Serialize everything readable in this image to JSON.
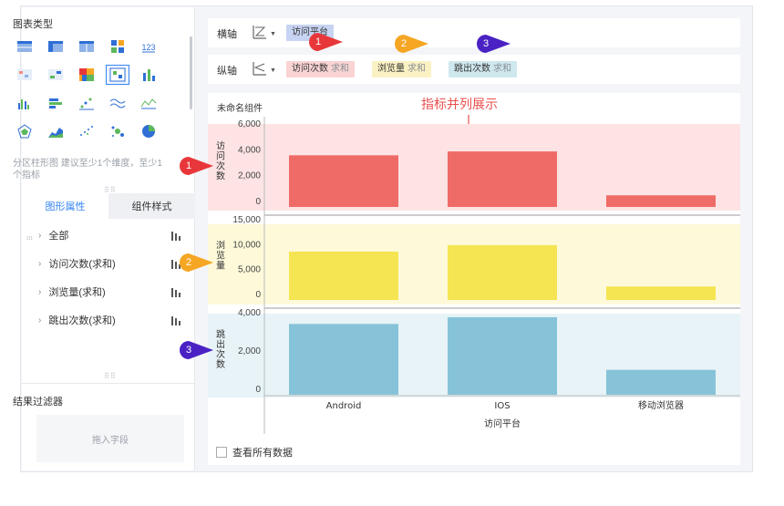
{
  "left_panel": {
    "chart_type_title": "图表类型",
    "chart_types": [
      {
        "icon": "table-icon"
      },
      {
        "icon": "pivot-table-icon"
      },
      {
        "icon": "detail-table-icon"
      },
      {
        "icon": "tile-grid-icon"
      },
      {
        "icon": "number-kpi-icon",
        "text": "123"
      },
      {
        "icon": "colored-table-icon"
      },
      {
        "icon": "cross-table-icon"
      },
      {
        "icon": "heatmap-icon"
      },
      {
        "icon": "scatter-grid-icon"
      },
      {
        "icon": "bar-chart-icon"
      },
      {
        "icon": "column-chart-icon"
      },
      {
        "icon": "stacked-bar-icon"
      },
      {
        "icon": "scatter-icon"
      },
      {
        "icon": "wave-line-icon"
      },
      {
        "icon": "line-chart-icon"
      },
      {
        "icon": "radar-icon"
      },
      {
        "icon": "area-chart-icon"
      },
      {
        "icon": "dot-scatter-icon"
      },
      {
        "icon": "bubble-icon"
      },
      {
        "icon": "pie-chart-icon"
      }
    ],
    "hint": "分区柱形图 建议至少1个维度，至少1个指标",
    "tabs": [
      "图形属性",
      "组件样式"
    ],
    "properties": [
      "全部",
      "访问次数(求和)",
      "浏览量(求和)",
      "跳出次数(求和)"
    ],
    "filter_title": "结果过滤器",
    "filter_placeholder": "拖入字段"
  },
  "x_axis": {
    "label": "横轴",
    "fields": [
      {
        "name": "访问平台"
      }
    ]
  },
  "y_axis": {
    "label": "纵轴",
    "fields": [
      {
        "name": "访问次数",
        "agg": "求和",
        "color": "#f9d4d3"
      },
      {
        "name": "浏览量",
        "agg": "求和",
        "color": "#fbf2c4"
      },
      {
        "name": "跳出次数",
        "agg": "求和",
        "color": "#cfe8ee"
      }
    ]
  },
  "widget": {
    "title": "未命名组件",
    "annotation": "指标并列展示",
    "view_all": "查看所有数据"
  },
  "badges": [
    "1",
    "2",
    "3",
    "1",
    "2",
    "3"
  ],
  "colors": {
    "accent": "#3685f2",
    "red_bar": "#ef6b67",
    "yellow_bar": "#f5e552",
    "blue_bar": "#86c3d8",
    "red_badge": "#e8373a",
    "yellow_badge": "#f5a623",
    "purple_badge": "#4a22c4"
  },
  "chart_data": {
    "type": "bar",
    "categories": [
      "Android",
      "IOS",
      "移动浏览器"
    ],
    "xlabel": "访问平台",
    "panels": [
      {
        "name": "访问次数",
        "values": [
          4000,
          4300,
          900
        ],
        "ticks": [
          "6,000",
          "4,000",
          "2,000",
          "0"
        ],
        "ylim": [
          0,
          6000
        ]
      },
      {
        "name": "浏览量",
        "values": [
          9700,
          11000,
          2700
        ],
        "ticks": [
          "15,000",
          "10,000",
          "5,000",
          "0"
        ],
        "ylim": [
          0,
          15000
        ]
      },
      {
        "name": "跳出次数",
        "values": [
          3700,
          4050,
          1300
        ],
        "ticks": [
          "4,000",
          "2,000",
          "0"
        ],
        "ylim": [
          0,
          4000
        ]
      }
    ],
    "panel_labels": [
      "访问次数",
      "浏览量",
      "跳出次数"
    ]
  }
}
